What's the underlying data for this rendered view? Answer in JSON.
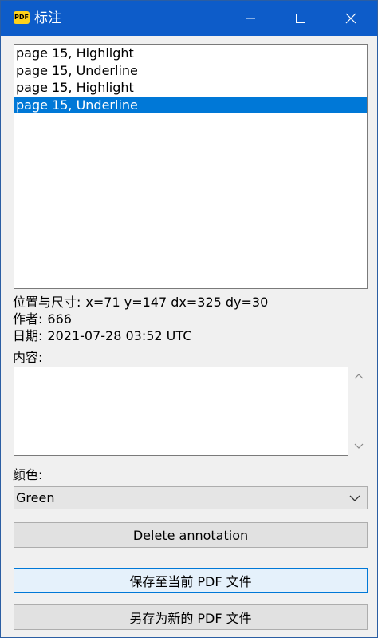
{
  "window": {
    "title": "标注",
    "app_icon": "PDF"
  },
  "annotation_list": {
    "items": [
      {
        "label": "page 15, Highlight",
        "selected": false
      },
      {
        "label": "page 15, Underline",
        "selected": false
      },
      {
        "label": "page 15, Highlight",
        "selected": false
      },
      {
        "label": "page 15, Underline",
        "selected": true
      }
    ]
  },
  "details": {
    "position_label": "位置与尺寸:",
    "position_value": "x=71 y=147 dx=325 dy=30",
    "author_label": "作者:",
    "author_value": "666",
    "date_label": "日期:",
    "date_value": "2021-07-28 03:52 UTC",
    "content_label": "内容:",
    "content_value": ""
  },
  "color": {
    "label": "颜色:",
    "selected": "Green"
  },
  "buttons": {
    "delete": "Delete annotation",
    "save_current": "保存至当前 PDF 文件",
    "save_new": "另存为新的 PDF 文件"
  },
  "colors": {
    "titlebar": "#0d5cc9",
    "selection": "#0078d7"
  }
}
